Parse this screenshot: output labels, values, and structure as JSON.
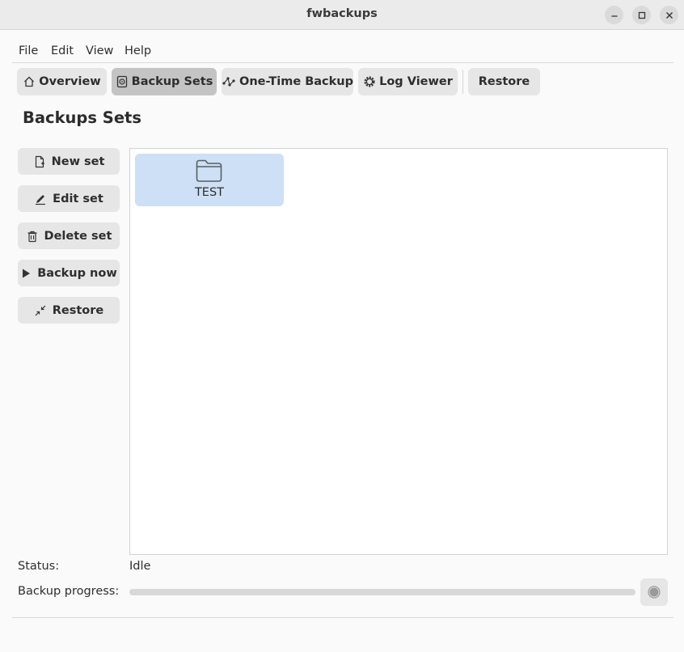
{
  "window": {
    "title": "fwbackups"
  },
  "menu": {
    "items": [
      "File",
      "Edit",
      "View",
      "Help"
    ]
  },
  "toolbar": {
    "tabs": [
      {
        "label": "Overview",
        "icon": "home-icon"
      },
      {
        "label": "Backup Sets",
        "icon": "drive-icon",
        "active": true
      },
      {
        "label": "One-Time Backup",
        "icon": "node-graph-icon"
      },
      {
        "label": "Log Viewer",
        "icon": "gear-icon"
      },
      {
        "label": "Restore"
      }
    ]
  },
  "page": {
    "title": "Backups Sets"
  },
  "sidebar": {
    "buttons": [
      {
        "label": "New set",
        "icon": "new-document-icon"
      },
      {
        "label": "Edit set",
        "icon": "pencil-icon"
      },
      {
        "label": "Delete set",
        "icon": "trash-icon"
      },
      {
        "label": "Backup now",
        "icon": "play-icon"
      },
      {
        "label": "Restore",
        "icon": "shrink-arrows-icon"
      }
    ]
  },
  "sets": [
    {
      "name": "TEST",
      "icon": "folder-icon",
      "selected": true
    }
  ],
  "status": {
    "label": "Status:",
    "value": "Idle"
  },
  "progress": {
    "label": "Backup progress:",
    "fraction": 0
  },
  "colors": {
    "selection": "#cde0f5",
    "accent": "#3584e4"
  }
}
